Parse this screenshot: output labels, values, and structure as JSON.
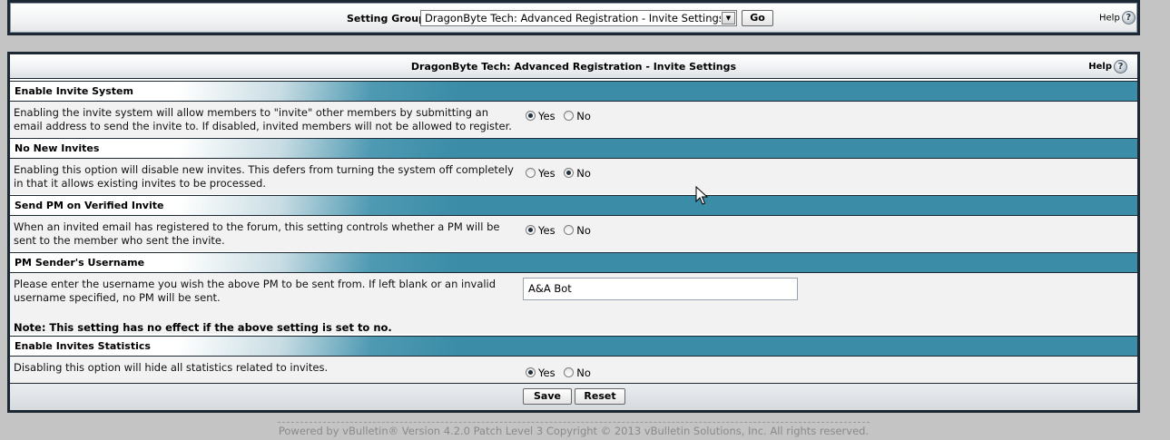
{
  "setting_group": {
    "label": "Setting Group",
    "selected": "DragonByte Tech: Advanced Registration - Invite Settings",
    "go_label": "Go",
    "help_label": "Help",
    "help_glyph": "?"
  },
  "panel": {
    "title": "DragonByte Tech: Advanced Registration - Invite Settings",
    "help_label": "Help",
    "help_glyph": "?"
  },
  "settings": [
    {
      "title": "Enable Invite System",
      "description": "Enabling the invite system will allow members to \"invite\" other members by submitting an email address to send the invite to. If disabled, invited members will not be allowed to register.",
      "yes_label": "Yes",
      "no_label": "No",
      "value": "yes"
    },
    {
      "title": "No New Invites",
      "description": "Enabling this option will disable new invites. This defers from turning the system off completely in that it allows existing invites to be processed.",
      "yes_label": "Yes",
      "no_label": "No",
      "value": "no"
    },
    {
      "title": "Send PM on Verified Invite",
      "description": "When an invited email has registered to the forum, this setting controls whether a PM will be sent to the member who sent the invite.",
      "yes_label": "Yes",
      "no_label": "No",
      "value": "yes"
    },
    {
      "title": "PM Sender's Username",
      "description": "Please enter the username you wish the above PM to be sent from. If left blank or an invalid username specified, no PM will be sent.",
      "note": "Note: This setting has no effect if the above setting is set to no.",
      "input_value": "A&A Bot"
    },
    {
      "title": "Enable Invites Statistics",
      "description": "Disabling this option will hide all statistics related to invites.",
      "yes_label": "Yes",
      "no_label": "No",
      "value": "yes"
    }
  ],
  "actions": {
    "save_label": "Save",
    "reset_label": "Reset"
  },
  "footer": {
    "copyright": "Powered by vBulletin® Version 4.2.0 Patch Level 3 Copyright © 2013 vBulletin Solutions, Inc. All rights reserved."
  },
  "colors": {
    "section_band": "#3a8ca7",
    "frame": "#1c2833",
    "page_bg": "#c4c4c4"
  },
  "icons": [
    "dropdown-arrow-icon",
    "help-icon",
    "mouse-cursor-icon"
  ]
}
